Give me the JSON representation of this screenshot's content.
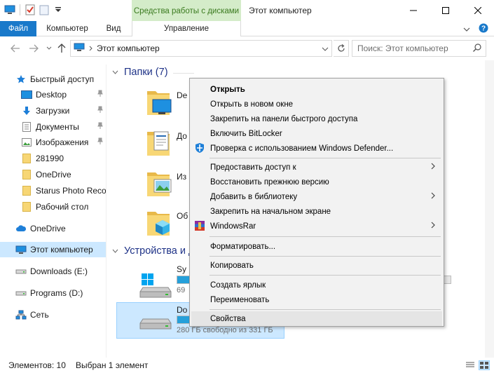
{
  "window": {
    "title": "Этот компьютер",
    "context_tab_header": "Средства работы с дисками"
  },
  "ribbon": {
    "tabs": [
      {
        "label": "Файл"
      },
      {
        "label": "Компьютер"
      },
      {
        "label": "Вид"
      },
      {
        "label": "Управление"
      }
    ]
  },
  "nav": {
    "address": "Этот компьютер",
    "search_placeholder": "Поиск: Этот компьютер"
  },
  "sidebar": {
    "items": [
      {
        "label": "Быстрый доступ"
      },
      {
        "label": "Desktop"
      },
      {
        "label": "Загрузки"
      },
      {
        "label": "Документы"
      },
      {
        "label": "Изображения"
      },
      {
        "label": "281990"
      },
      {
        "label": "OneDrive"
      },
      {
        "label": "Starus Photo Recov"
      },
      {
        "label": "Рабочий стол"
      },
      {
        "label": "OneDrive"
      },
      {
        "label": "Этот компьютер"
      },
      {
        "label": "Downloads (E:)"
      },
      {
        "label": "Programs (D:)"
      },
      {
        "label": "Сеть"
      }
    ]
  },
  "main": {
    "folders_header": "Папки (7)",
    "devices_header": "Устройства и д",
    "folders": [
      {
        "label": "De"
      },
      {
        "label": "До"
      },
      {
        "label": "Из"
      },
      {
        "label": "Об"
      }
    ],
    "drives": [
      {
        "name": "Sy",
        "free": "69",
        "used_fraction": 0.62
      },
      {
        "name": "Do",
        "free": "280 ГБ свободно из 331 ГБ",
        "used_fraction": 0.15
      }
    ]
  },
  "context_menu": {
    "items": [
      {
        "label": "Открыть"
      },
      {
        "label": "Открыть в новом окне"
      },
      {
        "label": "Закрепить на панели быстрого доступа"
      },
      {
        "label": "Включить BitLocker"
      },
      {
        "label": "Проверка с использованием Windows Defender..."
      },
      {
        "label": "Предоставить доступ к"
      },
      {
        "label": "Восстановить прежнюю версию"
      },
      {
        "label": "Добавить в библиотеку"
      },
      {
        "label": "Закрепить на начальном экране"
      },
      {
        "label": "WindowsRar"
      },
      {
        "label": "Форматировать..."
      },
      {
        "label": "Копировать"
      },
      {
        "label": "Создать ярлык"
      },
      {
        "label": "Переименовать"
      },
      {
        "label": "Свойства"
      }
    ]
  },
  "status": {
    "count": "Элементов: 10",
    "selected": "Выбран 1 элемент"
  },
  "colors": {
    "accent": "#1979ca",
    "selection": "#cce8ff",
    "context_tab": "#d4ecc9",
    "progress": "#26a0da"
  }
}
